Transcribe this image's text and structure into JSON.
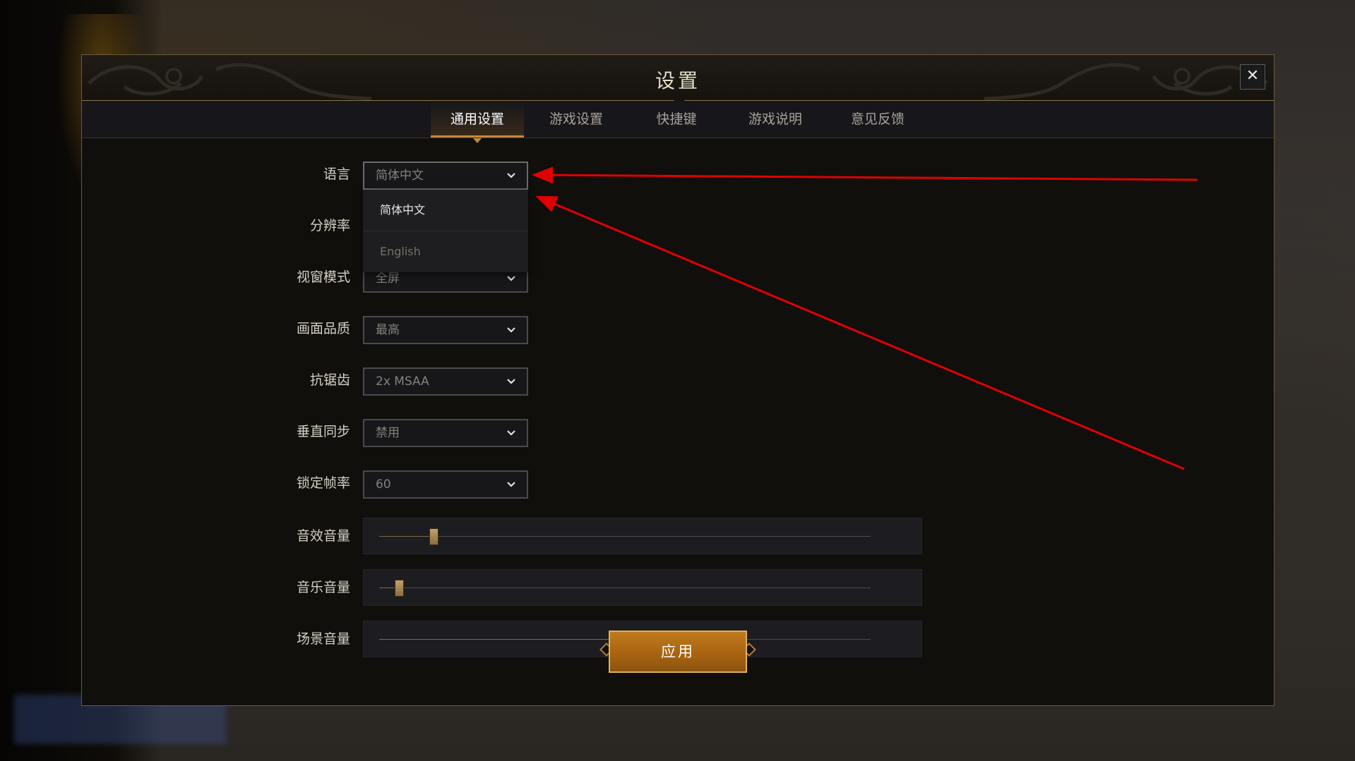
{
  "dialog": {
    "title": "设置",
    "close_symbol": "✕"
  },
  "tabs": [
    {
      "label": "通用设置",
      "active": true
    },
    {
      "label": "游戏设置",
      "active": false
    },
    {
      "label": "快捷键",
      "active": false
    },
    {
      "label": "游戏说明",
      "active": false
    },
    {
      "label": "意见反馈",
      "active": false
    }
  ],
  "settings": {
    "language": {
      "label": "语言",
      "value": "简体中文",
      "open": true,
      "options": [
        "简体中文",
        "English"
      ]
    },
    "resolution": {
      "label": "分辨率"
    },
    "window_mode": {
      "label": "视窗模式",
      "value": "全屏"
    },
    "quality": {
      "label": "画面品质",
      "value": "最高"
    },
    "antialiasing": {
      "label": "抗锯齿",
      "value": "2x MSAA"
    },
    "vsync": {
      "label": "垂直同步",
      "value": "禁用"
    },
    "fps_lock": {
      "label": "锁定帧率",
      "value": "60"
    },
    "sfx_volume": {
      "label": "音效音量",
      "level": 0.11
    },
    "music_volume": {
      "label": "音乐音量",
      "level": 0.04
    },
    "ambient_volume": {
      "label": "场景音量",
      "level": 0.59
    }
  },
  "apply_label": "应用",
  "colors": {
    "accent": "#c8883a",
    "annotation": "#e00000"
  },
  "icons": {
    "close": "close-icon",
    "dropdown": "chevron-down-icon"
  }
}
